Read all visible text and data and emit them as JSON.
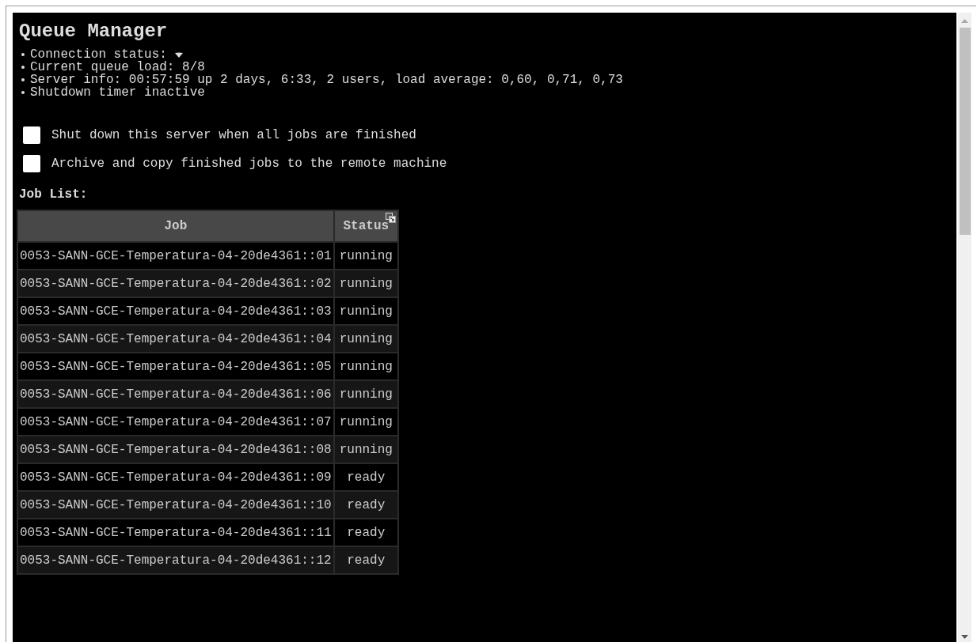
{
  "title": "Queue Manager",
  "info": [
    {
      "label": "Connection status:",
      "kind": "caret"
    },
    {
      "label": "Current queue load: 8/8",
      "kind": "text"
    },
    {
      "label": "Server info: 00:57:59 up 2 days, 6:33, 2 users, load average: 0,60, 0,71, 0,73",
      "kind": "text"
    },
    {
      "label": "Shutdown timer inactive",
      "kind": "text"
    }
  ],
  "options": [
    {
      "label": "Shut down this server when all jobs are finished",
      "checked": false
    },
    {
      "label": "Archive and copy finished jobs to the remote machine",
      "checked": false
    }
  ],
  "job_list": {
    "heading": "Job List:",
    "columns": [
      "Job",
      "Status"
    ],
    "rows": [
      [
        "0053-SANN-GCE-Temperatura-04-20de4361::01",
        "running"
      ],
      [
        "0053-SANN-GCE-Temperatura-04-20de4361::02",
        "running"
      ],
      [
        "0053-SANN-GCE-Temperatura-04-20de4361::03",
        "running"
      ],
      [
        "0053-SANN-GCE-Temperatura-04-20de4361::04",
        "running"
      ],
      [
        "0053-SANN-GCE-Temperatura-04-20de4361::05",
        "running"
      ],
      [
        "0053-SANN-GCE-Temperatura-04-20de4361::06",
        "running"
      ],
      [
        "0053-SANN-GCE-Temperatura-04-20de4361::07",
        "running"
      ],
      [
        "0053-SANN-GCE-Temperatura-04-20de4361::08",
        "running"
      ],
      [
        "0053-SANN-GCE-Temperatura-04-20de4361::09",
        "ready"
      ],
      [
        "0053-SANN-GCE-Temperatura-04-20de4361::10",
        "ready"
      ],
      [
        "0053-SANN-GCE-Temperatura-04-20de4361::11",
        "ready"
      ],
      [
        "0053-SANN-GCE-Temperatura-04-20de4361::12",
        "ready"
      ]
    ]
  }
}
